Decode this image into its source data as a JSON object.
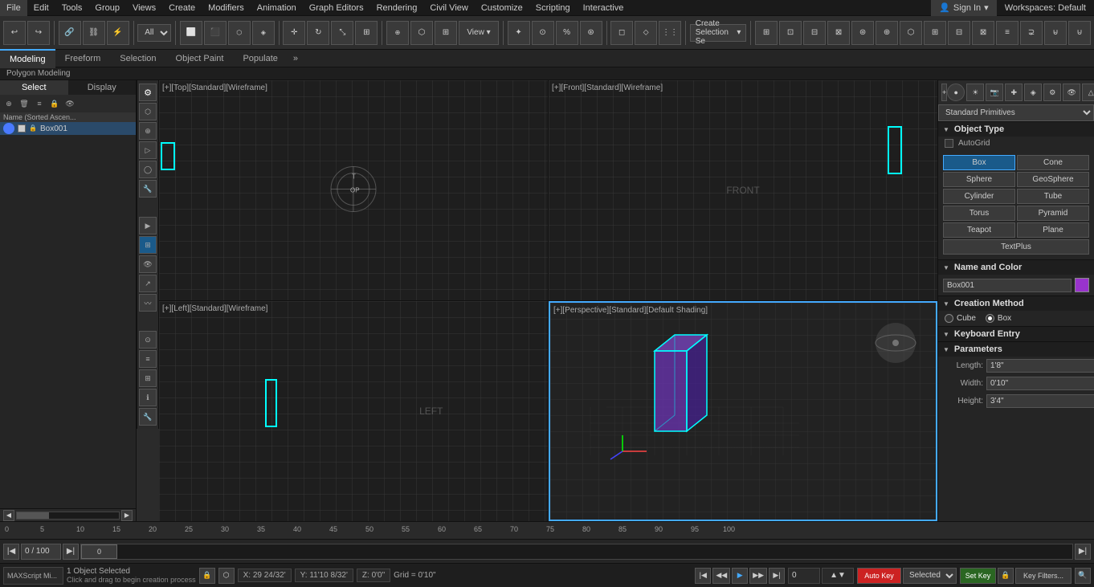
{
  "menu": {
    "items": [
      "File",
      "Edit",
      "Tools",
      "Group",
      "Views",
      "Create",
      "Modifiers",
      "Animation",
      "Graph Editors",
      "Rendering",
      "Civil View",
      "Customize",
      "Scripting",
      "Interactive"
    ]
  },
  "signin": {
    "label": "Sign In"
  },
  "workspaces": {
    "label": "Workspaces: Default"
  },
  "toolbar": {
    "filter": "All",
    "create_sel": "Create Selection Se"
  },
  "sub_tabs": {
    "items": [
      "Modeling",
      "Freeform",
      "Selection",
      "Object Paint",
      "Populate"
    ],
    "active": "Modeling"
  },
  "breadcrumb": "Polygon Modeling",
  "scene_explorer": {
    "tabs": [
      "Select",
      "Display"
    ],
    "active_tab": "Select",
    "header": "Name (Sorted Ascen...",
    "items": [
      {
        "name": "Box001",
        "selected": true
      }
    ]
  },
  "viewports": {
    "top": {
      "label": "[+][Top][Standard][Wireframe]"
    },
    "front": {
      "label": "[+][Front][Standard][Wireframe]"
    },
    "left": {
      "label": "[+][Left][Standard][Wireframe]"
    },
    "perspective": {
      "label": "[+][Perspective][Standard][Default Shading]"
    }
  },
  "right_panel": {
    "dropdown": "Standard Primitives",
    "object_type": {
      "title": "Object Type",
      "autogrid": "AutoGrid",
      "buttons": [
        "Box",
        "Cone",
        "Sphere",
        "GeoSphere",
        "Cylinder",
        "Tube",
        "Torus",
        "Pyramid",
        "Teapot",
        "Plane",
        "TextPlus"
      ],
      "active": "Box"
    },
    "name_and_color": {
      "title": "Name and Color",
      "value": "Box001"
    },
    "creation_method": {
      "title": "Creation Method",
      "options": [
        "Cube",
        "Box"
      ],
      "selected": "Box"
    },
    "keyboard_entry": {
      "title": "Keyboard Entry"
    },
    "parameters": {
      "title": "Parameters",
      "fields": [
        {
          "label": "Length:",
          "value": "1'8\""
        },
        {
          "label": "Width:",
          "value": "0'10\""
        },
        {
          "label": "Height:",
          "value": "3'4\""
        }
      ]
    }
  },
  "timeline": {
    "range": "0 / 100",
    "prev_frame": "◀",
    "next_frame": "▶",
    "start": "0",
    "end": "100"
  },
  "time_ruler": {
    "marks": [
      "0",
      "5",
      "10",
      "15",
      "20",
      "25",
      "30",
      "35",
      "40",
      "45",
      "50",
      "55",
      "60",
      "65",
      "70",
      "75",
      "80",
      "85",
      "90",
      "95",
      "100"
    ]
  },
  "status_bar": {
    "selected": "1 Object Selected",
    "hint": "Click and drag to begin creation process",
    "coords": {
      "x": "X: 29 24/32'",
      "y": "Y: 11'10 8/32'",
      "z": "Z: 0'0\""
    },
    "grid": "Grid = 0'10\"",
    "autokey": "Auto Key",
    "selected_label": "Selected",
    "setkey": "Set Key",
    "keyfilters": "Key Filters..."
  },
  "maxscript": "MAXScript Mi..."
}
